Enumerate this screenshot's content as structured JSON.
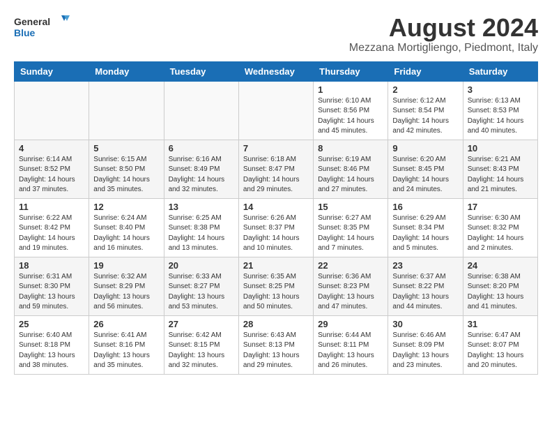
{
  "logo": {
    "text_general": "General",
    "text_blue": "Blue"
  },
  "header": {
    "month_year": "August 2024",
    "location": "Mezzana Mortigliengo, Piedmont, Italy"
  },
  "weekdays": [
    "Sunday",
    "Monday",
    "Tuesday",
    "Wednesday",
    "Thursday",
    "Friday",
    "Saturday"
  ],
  "weeks": [
    [
      {
        "day": "",
        "info": ""
      },
      {
        "day": "",
        "info": ""
      },
      {
        "day": "",
        "info": ""
      },
      {
        "day": "",
        "info": ""
      },
      {
        "day": "1",
        "info": "Sunrise: 6:10 AM\nSunset: 8:56 PM\nDaylight: 14 hours\nand 45 minutes."
      },
      {
        "day": "2",
        "info": "Sunrise: 6:12 AM\nSunset: 8:54 PM\nDaylight: 14 hours\nand 42 minutes."
      },
      {
        "day": "3",
        "info": "Sunrise: 6:13 AM\nSunset: 8:53 PM\nDaylight: 14 hours\nand 40 minutes."
      }
    ],
    [
      {
        "day": "4",
        "info": "Sunrise: 6:14 AM\nSunset: 8:52 PM\nDaylight: 14 hours\nand 37 minutes."
      },
      {
        "day": "5",
        "info": "Sunrise: 6:15 AM\nSunset: 8:50 PM\nDaylight: 14 hours\nand 35 minutes."
      },
      {
        "day": "6",
        "info": "Sunrise: 6:16 AM\nSunset: 8:49 PM\nDaylight: 14 hours\nand 32 minutes."
      },
      {
        "day": "7",
        "info": "Sunrise: 6:18 AM\nSunset: 8:47 PM\nDaylight: 14 hours\nand 29 minutes."
      },
      {
        "day": "8",
        "info": "Sunrise: 6:19 AM\nSunset: 8:46 PM\nDaylight: 14 hours\nand 27 minutes."
      },
      {
        "day": "9",
        "info": "Sunrise: 6:20 AM\nSunset: 8:45 PM\nDaylight: 14 hours\nand 24 minutes."
      },
      {
        "day": "10",
        "info": "Sunrise: 6:21 AM\nSunset: 8:43 PM\nDaylight: 14 hours\nand 21 minutes."
      }
    ],
    [
      {
        "day": "11",
        "info": "Sunrise: 6:22 AM\nSunset: 8:42 PM\nDaylight: 14 hours\nand 19 minutes."
      },
      {
        "day": "12",
        "info": "Sunrise: 6:24 AM\nSunset: 8:40 PM\nDaylight: 14 hours\nand 16 minutes."
      },
      {
        "day": "13",
        "info": "Sunrise: 6:25 AM\nSunset: 8:38 PM\nDaylight: 14 hours\nand 13 minutes."
      },
      {
        "day": "14",
        "info": "Sunrise: 6:26 AM\nSunset: 8:37 PM\nDaylight: 14 hours\nand 10 minutes."
      },
      {
        "day": "15",
        "info": "Sunrise: 6:27 AM\nSunset: 8:35 PM\nDaylight: 14 hours\nand 7 minutes."
      },
      {
        "day": "16",
        "info": "Sunrise: 6:29 AM\nSunset: 8:34 PM\nDaylight: 14 hours\nand 5 minutes."
      },
      {
        "day": "17",
        "info": "Sunrise: 6:30 AM\nSunset: 8:32 PM\nDaylight: 14 hours\nand 2 minutes."
      }
    ],
    [
      {
        "day": "18",
        "info": "Sunrise: 6:31 AM\nSunset: 8:30 PM\nDaylight: 13 hours\nand 59 minutes."
      },
      {
        "day": "19",
        "info": "Sunrise: 6:32 AM\nSunset: 8:29 PM\nDaylight: 13 hours\nand 56 minutes."
      },
      {
        "day": "20",
        "info": "Sunrise: 6:33 AM\nSunset: 8:27 PM\nDaylight: 13 hours\nand 53 minutes."
      },
      {
        "day": "21",
        "info": "Sunrise: 6:35 AM\nSunset: 8:25 PM\nDaylight: 13 hours\nand 50 minutes."
      },
      {
        "day": "22",
        "info": "Sunrise: 6:36 AM\nSunset: 8:23 PM\nDaylight: 13 hours\nand 47 minutes."
      },
      {
        "day": "23",
        "info": "Sunrise: 6:37 AM\nSunset: 8:22 PM\nDaylight: 13 hours\nand 44 minutes."
      },
      {
        "day": "24",
        "info": "Sunrise: 6:38 AM\nSunset: 8:20 PM\nDaylight: 13 hours\nand 41 minutes."
      }
    ],
    [
      {
        "day": "25",
        "info": "Sunrise: 6:40 AM\nSunset: 8:18 PM\nDaylight: 13 hours\nand 38 minutes."
      },
      {
        "day": "26",
        "info": "Sunrise: 6:41 AM\nSunset: 8:16 PM\nDaylight: 13 hours\nand 35 minutes."
      },
      {
        "day": "27",
        "info": "Sunrise: 6:42 AM\nSunset: 8:15 PM\nDaylight: 13 hours\nand 32 minutes."
      },
      {
        "day": "28",
        "info": "Sunrise: 6:43 AM\nSunset: 8:13 PM\nDaylight: 13 hours\nand 29 minutes."
      },
      {
        "day": "29",
        "info": "Sunrise: 6:44 AM\nSunset: 8:11 PM\nDaylight: 13 hours\nand 26 minutes."
      },
      {
        "day": "30",
        "info": "Sunrise: 6:46 AM\nSunset: 8:09 PM\nDaylight: 13 hours\nand 23 minutes."
      },
      {
        "day": "31",
        "info": "Sunrise: 6:47 AM\nSunset: 8:07 PM\nDaylight: 13 hours\nand 20 minutes."
      }
    ]
  ]
}
